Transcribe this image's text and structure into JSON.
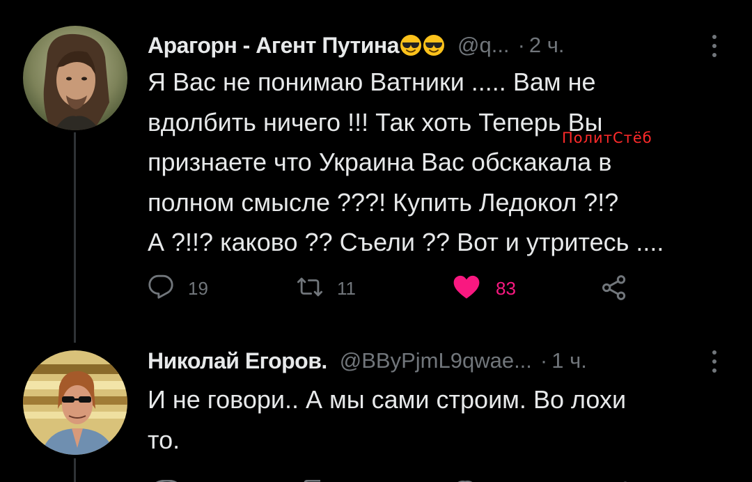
{
  "tweets": [
    {
      "author_name": "Арагорн - Агент Путина",
      "name_emojis": [
        "smiling-face-with-sunglasses",
        "smiling-face-with-sunglasses"
      ],
      "handle": "@q...",
      "separator": "·",
      "time": "2 ч.",
      "text": "Я Вас не понимаю Ватники ..... Вам не\nвдолбить ничего !!! Так хоть Теперь Вы\nпризнаете что Украина Вас обскакала в\nполном смысле ???! Купить Ледокол ?!?\nА ?!!? каково ?? Съели ?? Вот и утритесь ....",
      "watermark": "ПолитСтёб",
      "actions": {
        "replies": "19",
        "retweets": "11",
        "likes": "83",
        "liked": true
      }
    },
    {
      "author_name": "Николай Егоров.",
      "handle": "@BByPjmL9qwae...",
      "separator": "·",
      "time": "1 ч.",
      "text": "И не говори.. А мы сами строим. Во лохи\nто."
    }
  ],
  "colors": {
    "background": "#000000",
    "primary_text": "#e7e9ea",
    "secondary_text": "#71767b",
    "like": "#f91880",
    "watermark": "#ff2a2a",
    "thread_line": "#2f3336"
  }
}
